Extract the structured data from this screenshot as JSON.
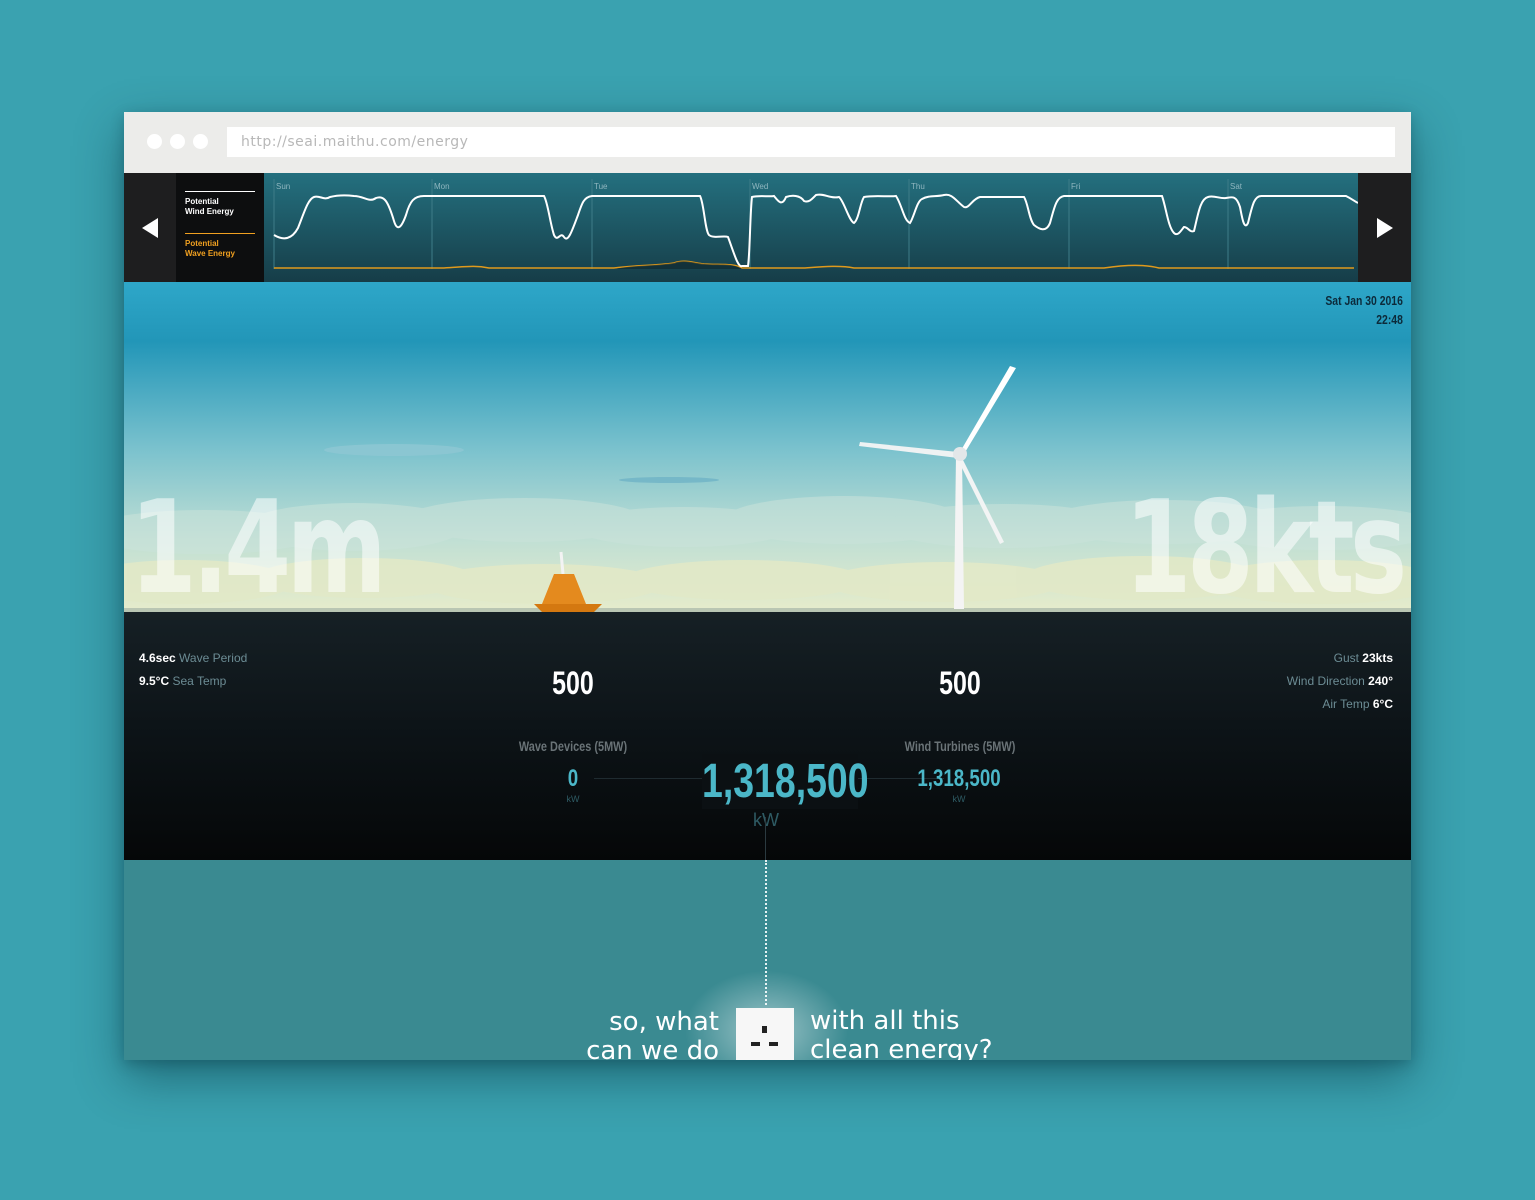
{
  "browser": {
    "url": "http://seai.maithu.com/energy"
  },
  "timeline": {
    "legend_wind": "Potential Wind Energy",
    "legend_wind_l1": "Potential",
    "legend_wind_l2": "Wind Energy",
    "legend_wave_l1": "Potential",
    "legend_wave_l2": "Wave Energy",
    "days": [
      "Sun",
      "Mon",
      "Tue",
      "Wed",
      "Thu",
      "Fri",
      "Sat"
    ],
    "colors": {
      "wind": "#ffffff",
      "wave": "#f0a020"
    }
  },
  "scene": {
    "wave_height": "1.4m",
    "wind_speed": "18kts",
    "date": "Sat Jan 30 2016",
    "time": "22:48"
  },
  "stats": {
    "wave_period_value": "4.6sec",
    "wave_period_label": "Wave Period",
    "sea_temp_value": "9.5°C",
    "sea_temp_label": "Sea Temp",
    "gust_label": "Gust",
    "gust_value": "23kts",
    "wind_dir_label": "Wind Direction",
    "wind_dir_value": "240°",
    "air_temp_label": "Air Temp",
    "air_temp_value": "6°C"
  },
  "output": {
    "wave_devices_count": "500",
    "wind_turbines_count": "500",
    "wave_devices_label": "Wave Devices (5MW)",
    "wind_turbines_label": "Wind Turbines (5MW)",
    "wave_kw": "0",
    "wind_kw": "1,318,500",
    "total_kw": "1,318,500",
    "unit": "kW"
  },
  "cta": {
    "left_line1": "so, what",
    "left_line2": "can we do",
    "right_line1": "with all this",
    "right_line2": "clean energy?"
  }
}
